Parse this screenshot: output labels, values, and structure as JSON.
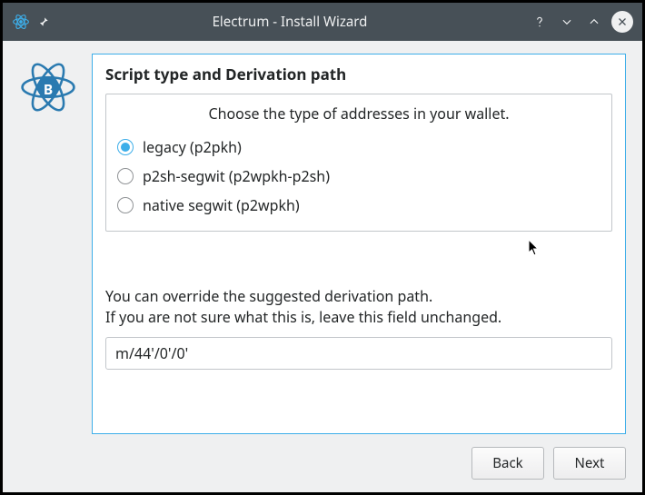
{
  "window": {
    "title": "Electrum  -  Install Wizard"
  },
  "section": {
    "title": "Script type and Derivation path",
    "group_caption": "Choose the type of addresses in your wallet.",
    "options": [
      {
        "label": "legacy (p2pkh)",
        "checked": true
      },
      {
        "label": "p2sh-segwit (p2wpkh-p2sh)",
        "checked": false
      },
      {
        "label": "native segwit (p2wpkh)",
        "checked": false
      }
    ],
    "hint_line1": "You can override the suggested derivation path.",
    "hint_line2": "If you are not sure what this is, leave this field unchanged.",
    "derivation_path": "m/44'/0'/0'"
  },
  "footer": {
    "back": "Back",
    "next": "Next"
  },
  "colors": {
    "accent": "#3daee9",
    "titlebar": "#475057",
    "window_bg": "#eff0f1"
  }
}
